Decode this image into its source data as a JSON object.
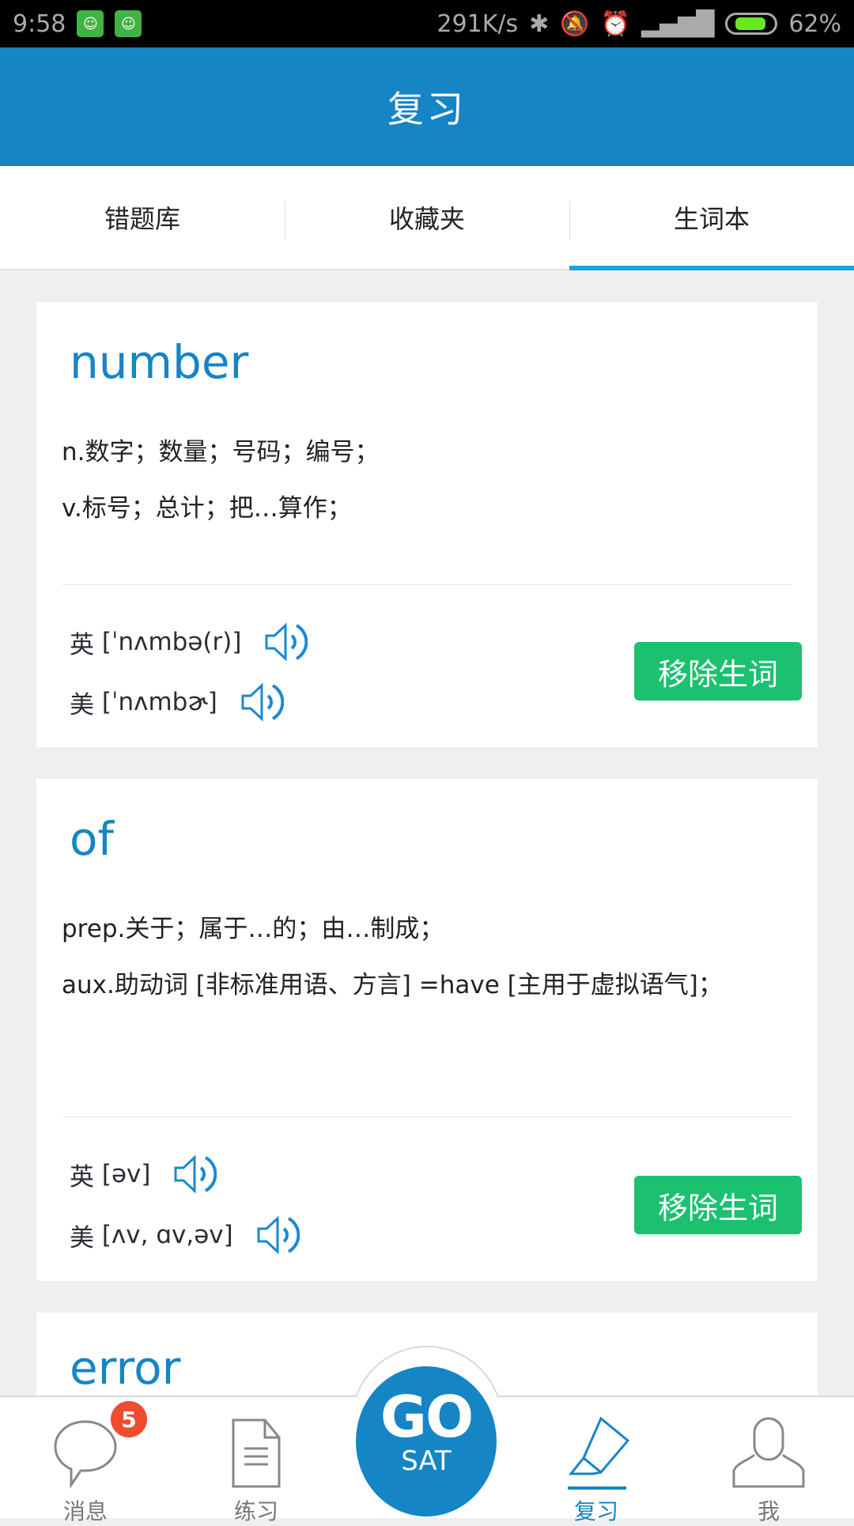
{
  "status": {
    "time": "9:58",
    "speed": "291K/s",
    "battery": "62%",
    "battery_level": 0.62
  },
  "header": {
    "title": "复习"
  },
  "tabs": [
    {
      "label": "错题库"
    },
    {
      "label": "收藏夹"
    },
    {
      "label": "生词本",
      "active": true
    }
  ],
  "cards": [
    {
      "word": "number",
      "defs": [
        "n.数字；数量；号码；编号；",
        "v.标号；总计；把…算作；"
      ],
      "uk": {
        "label": "英",
        "ipa": "[ˈnʌmbə(r)]"
      },
      "us": {
        "label": "美",
        "ipa": "[ˈnʌmbɚ]"
      },
      "remove": "移除生词"
    },
    {
      "word": "of",
      "defs": [
        "prep.关于；属于…的；由…制成；",
        "aux.助动词 [非标准用语、方言] =have [主用于虚拟语气]；"
      ],
      "uk": {
        "label": "英",
        "ipa": "[əv]"
      },
      "us": {
        "label": "美",
        "ipa": "[ʌv, ɑv,əv]"
      },
      "remove": "移除生词"
    },
    {
      "word": "error"
    }
  ],
  "nav": {
    "messages": "消息",
    "badge": "5",
    "practice": "练习",
    "go_top": "GO",
    "go_bottom": "SAT",
    "review": "复习",
    "me": "我"
  },
  "colors": {
    "primary": "#1585c5",
    "remove": "#1bc16f",
    "badge": "#f04a2f",
    "tab_indicator": "#1aa3e0"
  }
}
